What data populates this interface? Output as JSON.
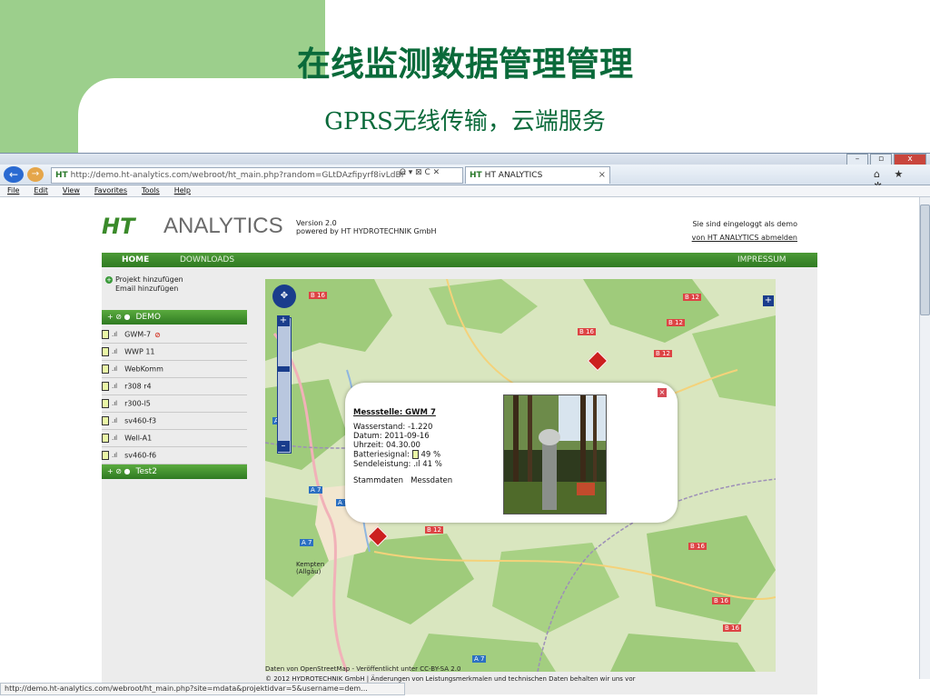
{
  "slide": {
    "title": "在线监测数据管理管理",
    "subtitle": "GPRS无线传输，云端服务"
  },
  "browser": {
    "window_buttons": [
      "–",
      "▫",
      "x"
    ],
    "address": "http://demo.ht-analytics.com/webroot/ht_main.php?random=GLtDAzfipyrf8ivLdBF",
    "address_badge": "HT",
    "address_icons": "Ω ▾ ⊠ C ✕",
    "tab_title": "HT ANALYTICS",
    "tab_close": "×",
    "tools": "⌂ ★ ✲",
    "menu": [
      "File",
      "Edit",
      "View",
      "Favorites",
      "Tools",
      "Help"
    ],
    "status_url": "http://demo.ht-analytics.com/webroot/ht_main.php?site=mdata&projektidvar=5&username=dem..."
  },
  "page": {
    "logo_mark": "HT",
    "logo_text": "ANALYTICS",
    "version_line1": "Version 2.0",
    "version_line2": "powered by HT HYDROTECHNIK GmbH",
    "login_status": "Sie sind eingeloggt als demo",
    "logout_link": "von HT ANALYTICS abmelden",
    "nav": {
      "home": "HOME",
      "downloads": "DOWNLOADS",
      "impressum": "IMPRESSUM"
    },
    "side_links": [
      "Projekt hinzufügen",
      "Email hinzufügen"
    ],
    "groups": [
      "DEMO",
      "Test2"
    ],
    "sites": [
      {
        "name": "GWM-7",
        "warning": true
      },
      {
        "name": "WWP 11",
        "warning": false
      },
      {
        "name": "WebKomm",
        "warning": false
      },
      {
        "name": "r308 r4",
        "warning": false
      },
      {
        "name": "r300-l5",
        "warning": false
      },
      {
        "name": "sv460-f3",
        "warning": false
      },
      {
        "name": "Well-A1",
        "warning": false
      },
      {
        "name": "sv460-f6",
        "warning": false
      }
    ],
    "map": {
      "road_labels": [
        "B 16",
        "B 12",
        "B 12",
        "B 16",
        "B 12",
        "A 7",
        "A 7",
        "A 7",
        "A 7",
        "B 12",
        "B 16",
        "B 16",
        "B 16",
        "A 7"
      ],
      "city": "Kempten (Allgäu)",
      "attribution": "Daten von OpenStreetMap - Veröffentlicht unter CC-BY-SA 2.0",
      "footer": "© 2012 HYDROTECHNIK GmbH | Änderungen von Leistungsmerkmalen und technischen Daten behalten wir uns vor"
    },
    "popup": {
      "heading": "Messstelle: GWM 7",
      "wasserstand": "Wasserstand: -1.220",
      "datum": "Datum: 2011-09-16",
      "uhrzeit": "Uhrzeit: 04.30.00",
      "battery": "Batteriesignal:",
      "battery_value": "49 %",
      "send": "Sendeleistung:",
      "send_value": "41 %",
      "link_stammdaten": "Stammdaten",
      "link_messdaten": "Messdaten",
      "close": "×"
    },
    "colors": {
      "brand_green": "#2f7a22",
      "map_control": "#1a3d8c",
      "alert_red": "#cc1f1f"
    }
  }
}
